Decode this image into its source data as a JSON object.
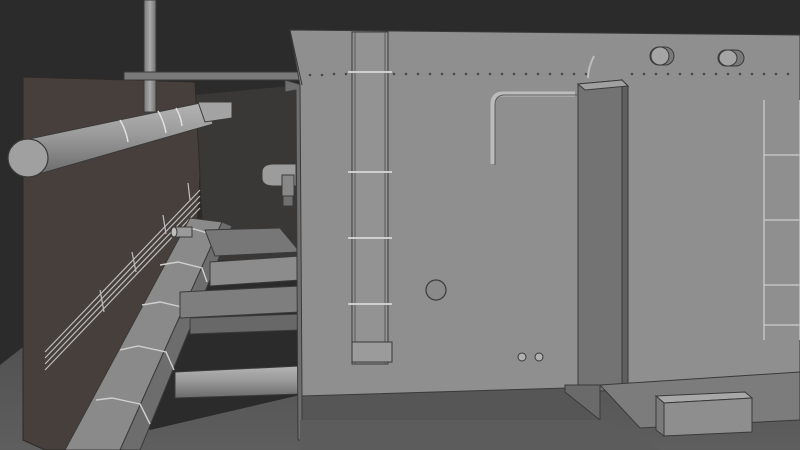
{
  "scene": {
    "kind": "3d-viewport-render",
    "shading": "solid-grey",
    "colors": {
      "background": "#2b2b2b",
      "floor": "#5a5a5a",
      "left_wall": "#473f3b",
      "tank_face": "#8f8f8f",
      "tank_side": "#6b6b6b",
      "pipe": "#9a9a9a",
      "pipe_shadow": "#6e6e6e",
      "outline": "#3a3a3a",
      "rivet": "#4a4a4a"
    },
    "objects": [
      "ceiling-pipe",
      "vertical-pipe",
      "left-wall",
      "cable-tray",
      "railing",
      "horizontal-pipes",
      "riveted-tank",
      "ladder",
      "bent-pipe",
      "vertical-duct",
      "round-hatch",
      "portholes",
      "junction-box",
      "valves"
    ]
  }
}
